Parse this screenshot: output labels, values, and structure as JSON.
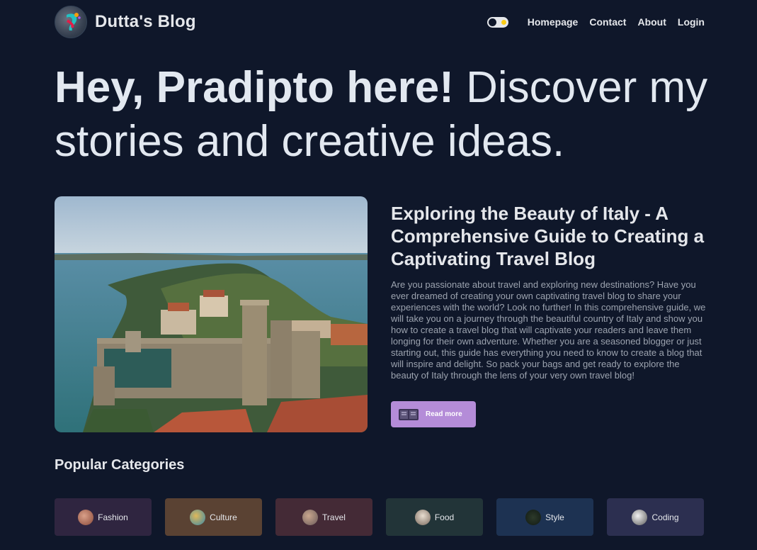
{
  "header": {
    "brand_name": "Dutta's Blog",
    "nav": [
      "Homepage",
      "Contact",
      "About",
      "Login"
    ]
  },
  "hero": {
    "bold": "Hey, Pradipto here!",
    "rest": " Discover my stories and creative ideas."
  },
  "featured": {
    "title": "Exploring the Beauty of Italy - A Comprehensive Guide to Creating a Captivating Travel Blog",
    "description": "Are you passionate about travel and exploring new destinations? Have you ever dreamed of creating your own captivating travel blog to share your experiences with the world? Look no further! In this comprehensive guide, we will take you on a journey through the beautiful country of Italy and show you how to create a travel blog that will captivate your readers and leave them longing for their own adventure. Whether you are a seasoned blogger or just starting out, this guide has everything you need to know to create a blog that will inspire and delight. So pack your bags and get ready to explore the beauty of Italy through the lens of your very own travel blog!",
    "button_label": "Read more",
    "button_color": "#b48cd8"
  },
  "categories": {
    "heading": "Popular Categories",
    "items": [
      {
        "label": "Fashion",
        "bg": "#2f2540",
        "icon": "fashion-thumb-icon"
      },
      {
        "label": "Culture",
        "bg": "#5a4233",
        "icon": "culture-thumb-icon"
      },
      {
        "label": "Travel",
        "bg": "#442a36",
        "icon": "travel-thumb-icon"
      },
      {
        "label": "Food",
        "bg": "#223438",
        "icon": "food-thumb-icon"
      },
      {
        "label": "Style",
        "bg": "#1d3252",
        "icon": "style-thumb-icon"
      },
      {
        "label": "Coding",
        "bg": "#2c2f50",
        "icon": "coding-thumb-icon"
      }
    ]
  },
  "colors": {
    "background": "#0f172a",
    "text": "#e5e7eb",
    "muted": "#9ca3af"
  }
}
